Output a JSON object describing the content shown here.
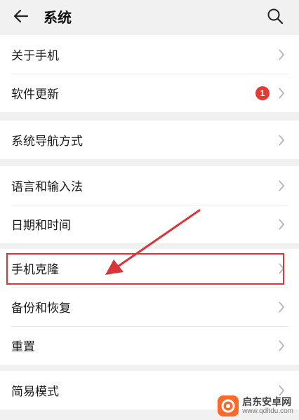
{
  "header": {
    "title": "系统",
    "back_icon": "back-arrow-icon",
    "search_icon": "search-icon"
  },
  "groups": [
    {
      "items": [
        {
          "label": "关于手机"
        },
        {
          "label": "软件更新",
          "badge": "1"
        }
      ]
    },
    {
      "items": [
        {
          "label": "系统导航方式"
        }
      ]
    },
    {
      "items": [
        {
          "label": "语言和输入法"
        },
        {
          "label": "日期和时间"
        }
      ]
    },
    {
      "items": [
        {
          "label": "手机克隆"
        },
        {
          "label": "备份和恢复"
        },
        {
          "label": "重置"
        }
      ]
    },
    {
      "items": [
        {
          "label": "简易模式"
        }
      ]
    }
  ],
  "annotation": {
    "highlighted_item": "手机克隆",
    "color": "#d9363a"
  },
  "colors": {
    "badge": "#e53935",
    "chevron": "#b5b5b5",
    "background": "#f1f1f1"
  },
  "watermark": {
    "text": "启东安卓网",
    "url": "www.qdltdu.com"
  }
}
